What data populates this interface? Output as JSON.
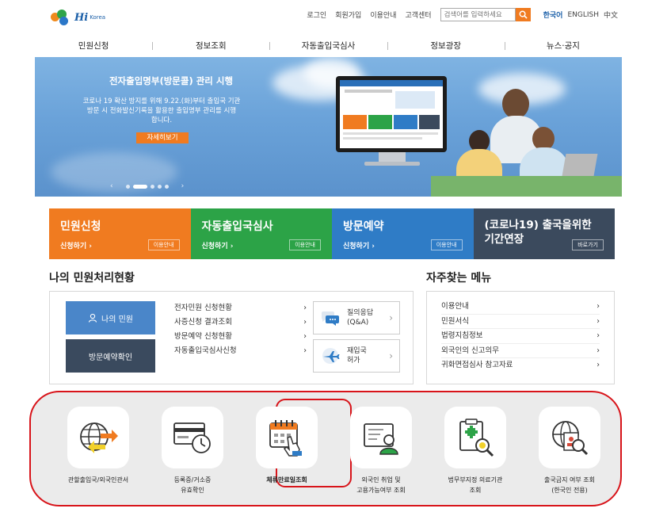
{
  "header": {
    "logo_text": "Hi",
    "logo_sub": "Korea",
    "links": [
      "로그인",
      "회원가입",
      "이용안내",
      "고객센터"
    ],
    "search_placeholder": "검색어를 입력하세요",
    "languages": [
      "한국어",
      "ENGLISH",
      "中文"
    ]
  },
  "nav": [
    "민원신청",
    "정보조회",
    "자동출입국심사",
    "정보광장",
    "뉴스·공지"
  ],
  "banner": {
    "title": "전자출입명부(방문콜) 관리 시행",
    "desc_lines": [
      "코로나 19 확산 방지를 위해 9.22.(화)부터 출입국 기관",
      "방문 시 전화발신기록을 활용한 출입명부 관리를 시행",
      "합니다."
    ],
    "more": "자세히보기",
    "prev": "‹",
    "next": "›"
  },
  "tiles": [
    {
      "title": "민원신청",
      "sub": "신청하기 ›",
      "btn": "이용안내",
      "color": "#f07b20"
    },
    {
      "title": "자동출입국심사",
      "sub": "신청하기 ›",
      "btn": "이용안내",
      "color": "#2ca347"
    },
    {
      "title": "방문예약",
      "sub": "신청하기 ›",
      "btn": "이용안내",
      "color": "#2f7cc6"
    },
    {
      "title": "(코로나19) 출국을위한",
      "title2": "기간연장",
      "btn": "바로가기",
      "color": "#3b4a5d"
    }
  ],
  "my_status": {
    "heading": "나의 민원처리현황",
    "my_button": "나의 민원",
    "visit_button": "방문예약확인",
    "list": [
      "전자민원 신청현황",
      "사증신청 결과조회",
      "방문예약 신청현황",
      "자동출입국심사신청"
    ],
    "arrow": "›",
    "qa": {
      "line1": "질의응답",
      "line2": "(Q&A)"
    },
    "reentry": {
      "line1": "재입국",
      "line2": "허가"
    }
  },
  "frequent": {
    "heading": "자주찾는 메뉴",
    "items": [
      "이용안내",
      "민원서식",
      "법령지침정보",
      "외국인의 신고의무",
      "귀화면접심사 참고자료"
    ]
  },
  "services": [
    {
      "line1": "관할출입국/외국인관서",
      "line2": ""
    },
    {
      "line1": "등록증/거소증",
      "line2": "유효확인"
    },
    {
      "line1": "체류만료일조회",
      "line2": ""
    },
    {
      "line1": "외국인 취업 및",
      "line2": "고용가능여부 조회"
    },
    {
      "line1": "법무부지정 의료기관",
      "line2": "조회"
    },
    {
      "line1": "출국금지 여부 조회",
      "line2": "(한국인 전용)"
    }
  ],
  "colors": {
    "accent": "#f07b20",
    "highlight": "#d8141a",
    "brand_blue": "#1b5fa8"
  }
}
